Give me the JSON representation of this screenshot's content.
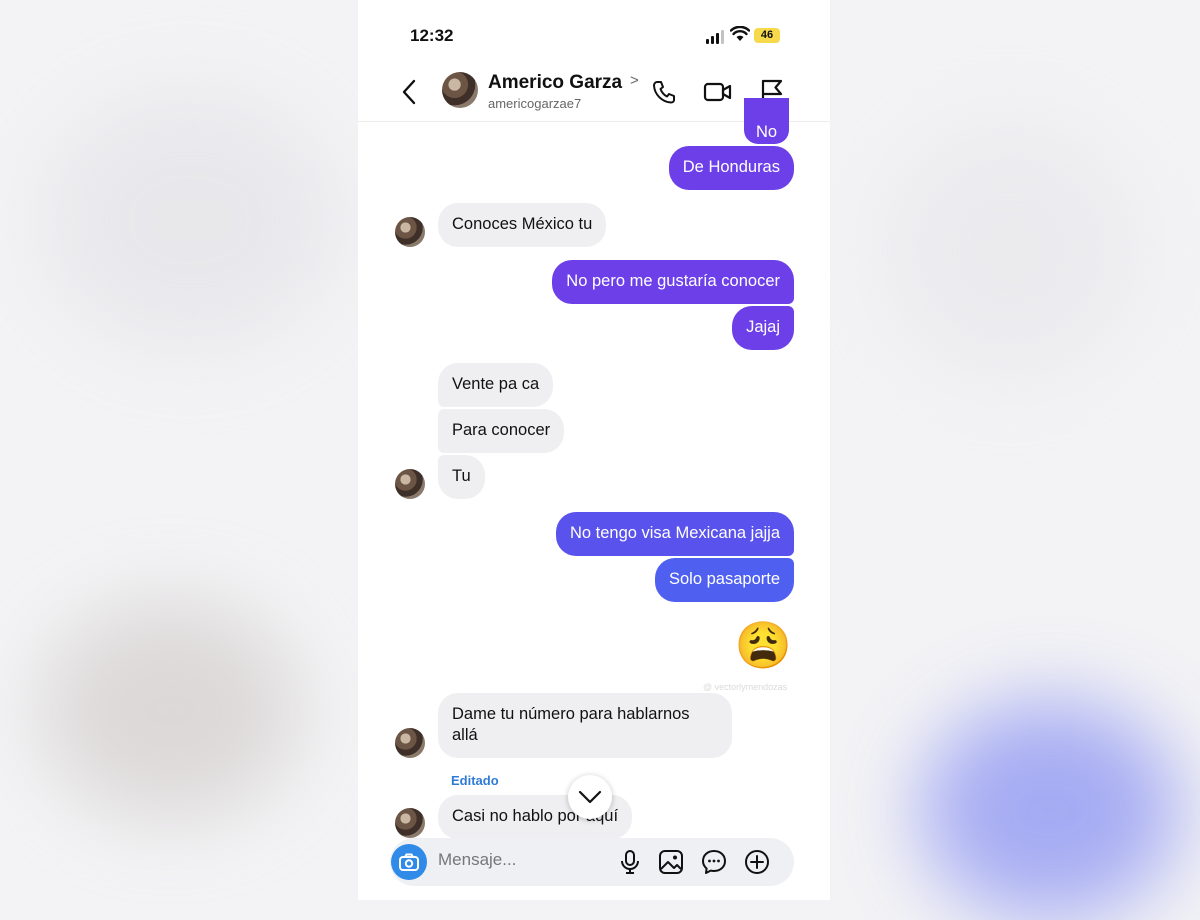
{
  "status_bar": {
    "time": "12:32",
    "battery": "46"
  },
  "header": {
    "name": "Americo Garza",
    "chevron": ">",
    "username": "americogarzae7"
  },
  "messages": [
    {
      "side": "out",
      "text": "No"
    },
    {
      "side": "out",
      "text": "De Honduras"
    },
    {
      "side": "in",
      "text": "Conoces México tu"
    },
    {
      "side": "out",
      "text": "No pero me gustaría conocer"
    },
    {
      "side": "out",
      "text": "Jajaj"
    },
    {
      "side": "in",
      "text": "Vente pa ca"
    },
    {
      "side": "in",
      "text": "Para conocer"
    },
    {
      "side": "in",
      "text": "Tu"
    },
    {
      "side": "out",
      "text": "No tengo visa Mexicana jajja"
    },
    {
      "side": "out",
      "text": "Solo pasaporte"
    },
    {
      "side": "out",
      "text": "😩"
    },
    {
      "side": "in",
      "text": "Dame tu número para hablarnos allá"
    },
    {
      "side": "in",
      "text": "Casi no hablo por aquí"
    }
  ],
  "edited_label": "Editado",
  "watermark": "@ vectorlymendozas",
  "composer": {
    "placeholder": "Mensaje..."
  },
  "colors": {
    "outgoing": "#6d3fe9",
    "incoming": "#efeff1",
    "camera": "#2f8ae8",
    "edited": "#2f7bd6"
  }
}
